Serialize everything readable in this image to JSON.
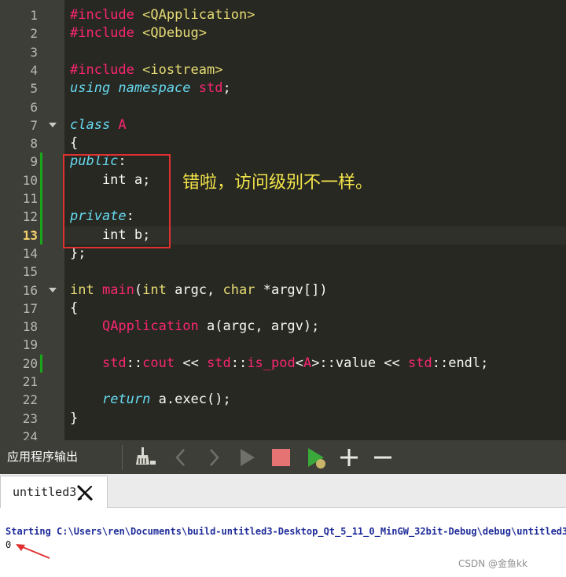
{
  "editor": {
    "lines": [
      {
        "n": "1",
        "tokens": [
          [
            "inc",
            "#include "
          ],
          [
            "str",
            "<QApplication>"
          ]
        ]
      },
      {
        "n": "2",
        "tokens": [
          [
            "inc",
            "#include "
          ],
          [
            "str",
            "<QDebug>"
          ]
        ]
      },
      {
        "n": "3",
        "tokens": []
      },
      {
        "n": "4",
        "tokens": [
          [
            "inc",
            "#include "
          ],
          [
            "str",
            "<iostream>"
          ]
        ]
      },
      {
        "n": "5",
        "tokens": [
          [
            "it",
            "using namespace "
          ],
          [
            "std",
            "std"
          ],
          [
            "p",
            ";"
          ]
        ]
      },
      {
        "n": "6",
        "tokens": []
      },
      {
        "n": "7",
        "tokens": [
          [
            "it",
            "class "
          ],
          [
            "cls",
            "A"
          ]
        ],
        "fold": true
      },
      {
        "n": "8",
        "tokens": [
          [
            "p",
            "{"
          ]
        ]
      },
      {
        "n": "9",
        "tokens": [
          [
            "it",
            "public"
          ],
          [
            "p",
            ":"
          ]
        ],
        "mark": true
      },
      {
        "n": "10",
        "tokens": [
          [
            "p",
            "    int a;"
          ]
        ],
        "mark": true
      },
      {
        "n": "11",
        "tokens": [],
        "mark": true
      },
      {
        "n": "12",
        "tokens": [
          [
            "it",
            "private"
          ],
          [
            "p",
            ":"
          ]
        ],
        "mark": true
      },
      {
        "n": "13",
        "tokens": [
          [
            "p",
            "    int b;"
          ]
        ],
        "mark": true,
        "current": true
      },
      {
        "n": "14",
        "tokens": [
          [
            "p",
            "};"
          ]
        ]
      },
      {
        "n": "15",
        "tokens": []
      },
      {
        "n": "16",
        "tokens": [
          [
            "type",
            "int "
          ],
          [
            "std",
            "main"
          ],
          [
            "p",
            "("
          ],
          [
            "type",
            "int "
          ],
          [
            "p",
            "argc, "
          ],
          [
            "type",
            "char "
          ],
          [
            "p",
            "*argv[])"
          ]
        ],
        "fold": true
      },
      {
        "n": "17",
        "tokens": [
          [
            "p",
            "{"
          ]
        ]
      },
      {
        "n": "18",
        "tokens": [
          [
            "p",
            "    "
          ],
          [
            "std",
            "QApplication"
          ],
          [
            "p",
            " a(argc, argv);"
          ]
        ]
      },
      {
        "n": "19",
        "tokens": []
      },
      {
        "n": "20",
        "tokens": [
          [
            "p",
            "    "
          ],
          [
            "std",
            "std"
          ],
          [
            "p",
            "::"
          ],
          [
            "std",
            "cout"
          ],
          [
            "p",
            " << "
          ],
          [
            "std",
            "std"
          ],
          [
            "p",
            "::"
          ],
          [
            "std",
            "is_pod"
          ],
          [
            "p",
            "<"
          ],
          [
            "std",
            "A"
          ],
          [
            "p",
            ">::value << "
          ],
          [
            "std",
            "std"
          ],
          [
            "p",
            "::endl;"
          ]
        ],
        "mark": true
      },
      {
        "n": "21",
        "tokens": []
      },
      {
        "n": "22",
        "tokens": [
          [
            "p",
            "    "
          ],
          [
            "it",
            "return"
          ],
          [
            "p",
            " a.exec();"
          ]
        ]
      },
      {
        "n": "23",
        "tokens": [
          [
            "p",
            "}"
          ]
        ]
      },
      {
        "n": "24",
        "tokens": []
      }
    ],
    "annotation": "错啦，访问级别不一样。"
  },
  "output_panel": {
    "title": "应用程序输出",
    "tab_label": "untitled3",
    "starting_line": "Starting C:\\Users\\ren\\Documents\\build-untitled3-Desktop_Qt_5_11_0_MinGW_32bit-Debug\\debug\\untitled3",
    "result": "0"
  },
  "watermark": "CSDN @金鱼kk",
  "colors": {
    "editor_bg": "#272822",
    "keyword_pink": "#f92672",
    "string_yellow": "#e6db74",
    "italic_cyan": "#66d9ef",
    "annotation_yellow": "#f2e34a",
    "box_red": "#e03030",
    "stop_red": "#e57373",
    "run_green": "#3aa83a"
  }
}
